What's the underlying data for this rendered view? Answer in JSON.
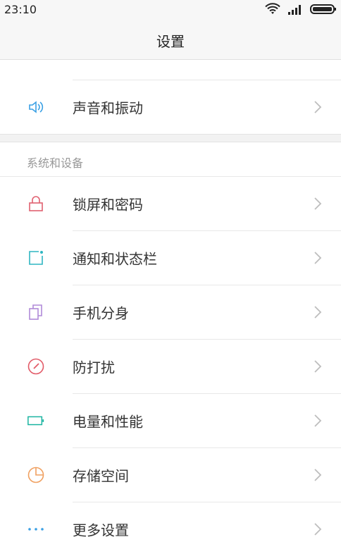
{
  "status_bar": {
    "time": "23:10"
  },
  "header": {
    "title": "设置"
  },
  "group_top": {
    "items": [
      {
        "label": "声音和振动",
        "icon": "speaker-icon",
        "color": "#3aa0e4"
      }
    ]
  },
  "section_system": {
    "title": "系统和设备",
    "items": [
      {
        "label": "锁屏和密码",
        "icon": "lock-icon",
        "color": "#e06070"
      },
      {
        "label": "通知和状态栏",
        "icon": "notification-icon",
        "color": "#2fb6c2"
      },
      {
        "label": "手机分身",
        "icon": "dual-space-icon",
        "color": "#b08ad9"
      },
      {
        "label": "防打扰",
        "icon": "do-not-disturb-icon",
        "color": "#e25a67"
      },
      {
        "label": "电量和性能",
        "icon": "battery-icon",
        "color": "#19b3a0"
      },
      {
        "label": "存储空间",
        "icon": "storage-pie-icon",
        "color": "#f0a060"
      },
      {
        "label": "更多设置",
        "icon": "more-dots-icon",
        "color": "#3aa0e4"
      }
    ]
  },
  "colors": {
    "chevron": "#bdbdbd",
    "divider": "#e8e8e8",
    "section_title": "#999999"
  }
}
